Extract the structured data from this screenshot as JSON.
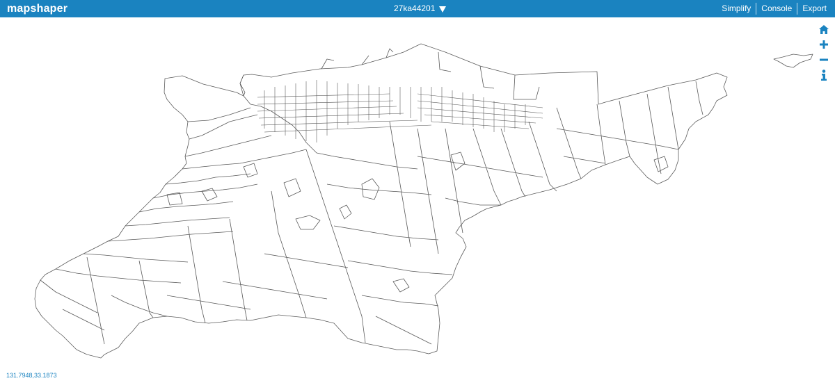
{
  "app": {
    "logo": "mapshaper"
  },
  "layer": {
    "name": "27ka44201"
  },
  "menu": {
    "simplify": "Simplify",
    "console": "Console",
    "export": "Export"
  },
  "nav": {
    "home_icon": "home-icon",
    "zoom_in_icon": "plus-icon",
    "zoom_out_icon": "minus-icon",
    "info_icon": "info-icon"
  },
  "status": {
    "coordinates": "131.7948,33.1873"
  },
  "colors": {
    "accent": "#1a83c0",
    "map_stroke": "#5a5a5a",
    "background": "#ffffff"
  }
}
